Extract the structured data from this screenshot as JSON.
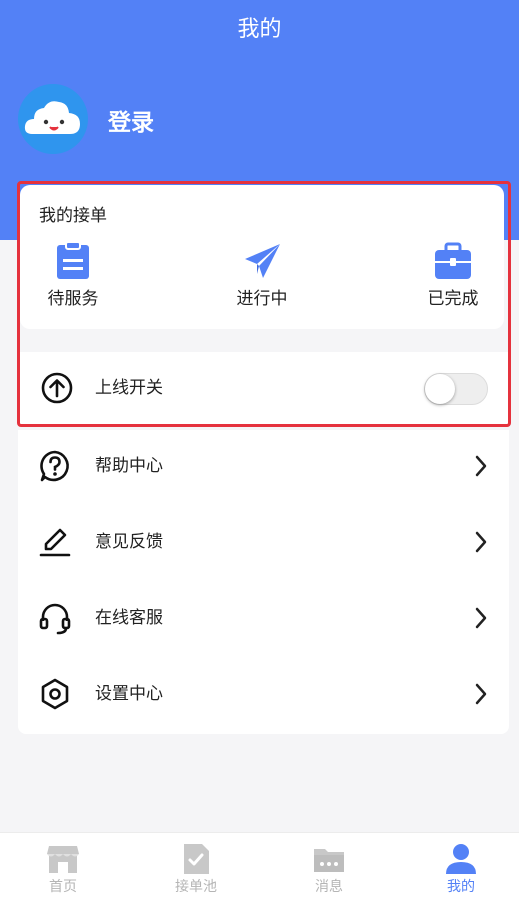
{
  "header": {
    "title": "我的"
  },
  "profile": {
    "login_label": "登录",
    "avatar_icon": "cloud-avatar-icon"
  },
  "my_orders": {
    "title": "我的接单",
    "items": [
      {
        "label": "待服务",
        "icon": "clipboard-icon"
      },
      {
        "label": "进行中",
        "icon": "paper-plane-icon"
      },
      {
        "label": "已完成",
        "icon": "briefcase-icon"
      }
    ]
  },
  "online_switch": {
    "label": "上线开关",
    "icon": "arrow-up-circle-icon",
    "enabled": false
  },
  "menu": [
    {
      "label": "帮助中心",
      "icon": "help-circle-icon"
    },
    {
      "label": "意见反馈",
      "icon": "pen-icon"
    },
    {
      "label": "在线客服",
      "icon": "headset-icon"
    },
    {
      "label": "设置中心",
      "icon": "hexagon-settings-icon"
    }
  ],
  "tabbar": [
    {
      "label": "首页",
      "icon": "store-icon",
      "active": false
    },
    {
      "label": "接单池",
      "icon": "checked-document-icon",
      "active": false
    },
    {
      "label": "消息",
      "icon": "message-folder-icon",
      "active": false
    },
    {
      "label": "我的",
      "icon": "user-icon",
      "active": true
    }
  ],
  "colors": {
    "primary": "#5381f6",
    "highlight_border": "#e5323d",
    "avatar_bg": "#2f95ee",
    "tab_inactive": "#b5b5b5",
    "background": "#f5f5f7"
  }
}
